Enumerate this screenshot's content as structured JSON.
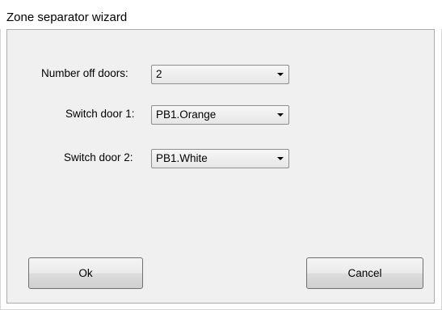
{
  "window": {
    "title": "Zone separator wizard"
  },
  "form": {
    "fields": [
      {
        "label": "Number off doors:",
        "value": "2"
      },
      {
        "label": "Switch door 1:",
        "value": "PB1.Orange"
      },
      {
        "label": "Switch door 2:",
        "value": "PB1.White"
      }
    ]
  },
  "buttons": {
    "ok_label": "Ok",
    "cancel_label": "Cancel"
  },
  "icons": {
    "dropdown": "chevron-down-icon"
  },
  "colors": {
    "dialog_background": "#f0f0f0",
    "button_border": "#707070",
    "combo_border": "#8f8f8f"
  }
}
